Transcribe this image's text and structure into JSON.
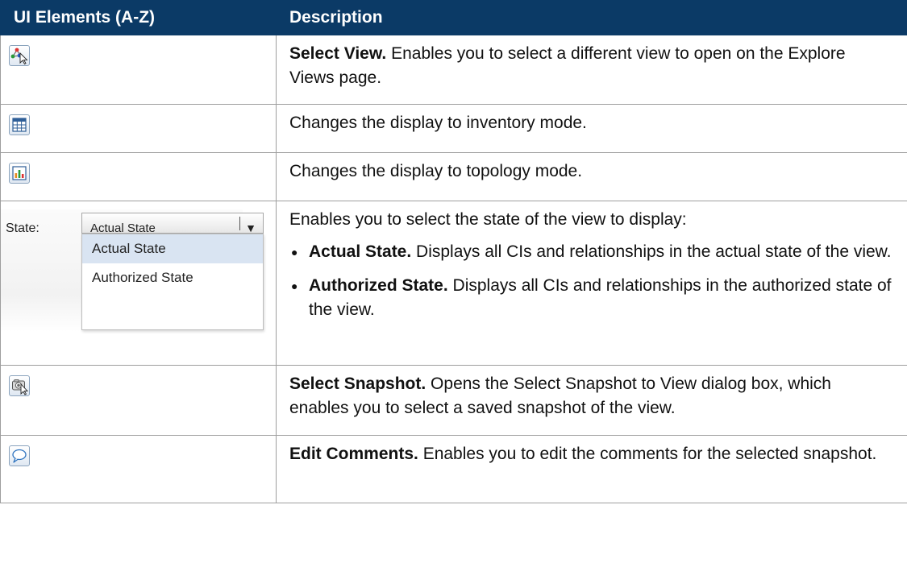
{
  "table": {
    "headers": {
      "elements": "UI Elements (A-Z)",
      "description": "Description"
    },
    "rows": [
      {
        "icon": "select-view-icon",
        "bold": "Select View.",
        "text": " Enables you to select a different view to open on the Explore Views page."
      },
      {
        "icon": "inventory-mode-icon",
        "text": "Changes the display to inventory mode."
      },
      {
        "icon": "topology-mode-icon",
        "text": "Changes the display to topology mode."
      },
      {
        "state_widget": {
          "label": "State:",
          "selected": "Actual State",
          "options": [
            "Actual State",
            "Authorized State"
          ]
        },
        "text": "Enables you to select the state of the view to display:",
        "bullets": [
          {
            "bold": "Actual State.",
            "text": " Displays all CIs and relationships in the actual state of the view."
          },
          {
            "bold": "Authorized State.",
            "text": " Displays all CIs and relationships in the authorized state of the view."
          }
        ]
      },
      {
        "icon": "select-snapshot-icon",
        "bold": "Select Snapshot.",
        "text": " Opens the Select Snapshot to View dialog box, which enables you to select a saved snapshot of the view."
      },
      {
        "icon": "edit-comments-icon",
        "bold": "Edit Comments.",
        "text": " Enables you to edit the comments for the selected snapshot."
      }
    ]
  },
  "colors": {
    "header_bg": "#0b3a66",
    "header_text": "#ffffff",
    "border": "#9e9e9e"
  }
}
